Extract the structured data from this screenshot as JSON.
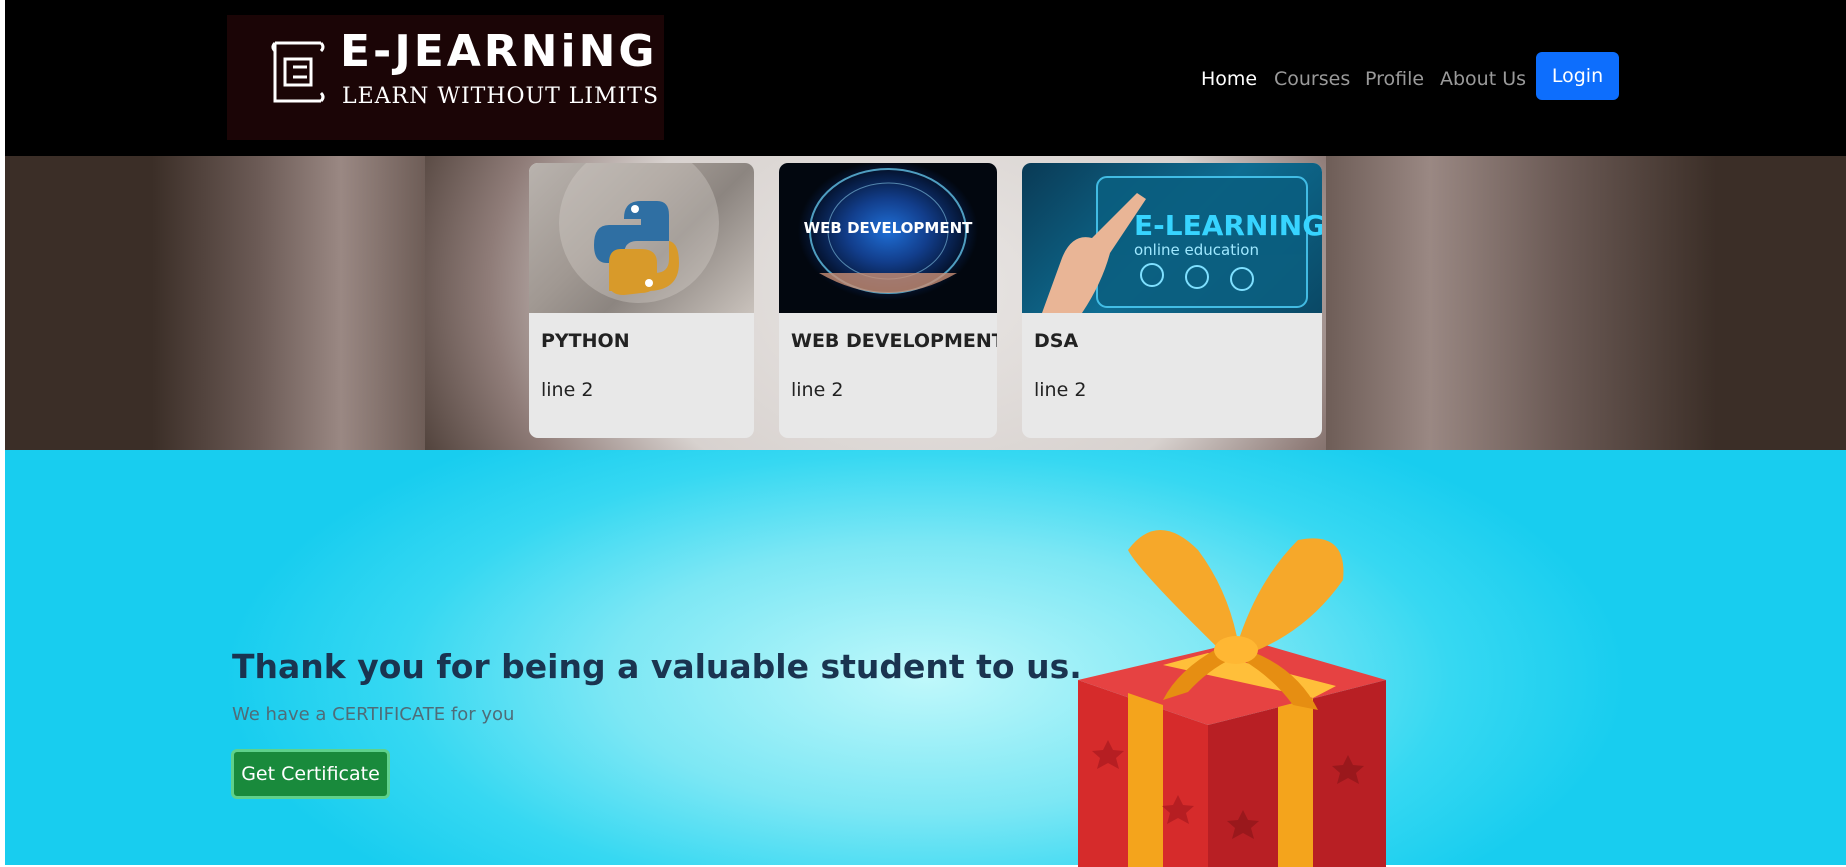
{
  "brand": {
    "title": "E-JEARNiNG",
    "tagline": "LEARN WITHOUT LIMITS"
  },
  "nav": {
    "items": [
      {
        "label": "Home",
        "active": true
      },
      {
        "label": "Courses",
        "active": false
      },
      {
        "label": "Profile",
        "active": false
      },
      {
        "label": "About Us",
        "active": false
      }
    ],
    "login_label": "Login"
  },
  "courses": [
    {
      "title": "PYTHON",
      "text": "line 2",
      "image": "python-logo-image"
    },
    {
      "title": "WEB DEVELOPMENT",
      "text": "line 2",
      "image": "web-development-globe-image"
    },
    {
      "title": "DSA",
      "text": "line 2",
      "image": "e-learning-online-education-image"
    }
  ],
  "course_images": {
    "web_caption": "WEB DEVELOPMENT",
    "dsa_caption_1": "E-LEARNING",
    "dsa_caption_2": "online education"
  },
  "hero": {
    "title": "Thank you for being a valuable student to us.",
    "subtitle": "We have a CERTIFICATE for you",
    "button_label": "Get Certificate",
    "image": "gift-box-image"
  },
  "colors": {
    "nav_bg": "#000000",
    "primary": "#0d6efd",
    "success": "#198a3c",
    "hero_bg": "#36d8f2",
    "card_bg": "#e8e8e8"
  }
}
